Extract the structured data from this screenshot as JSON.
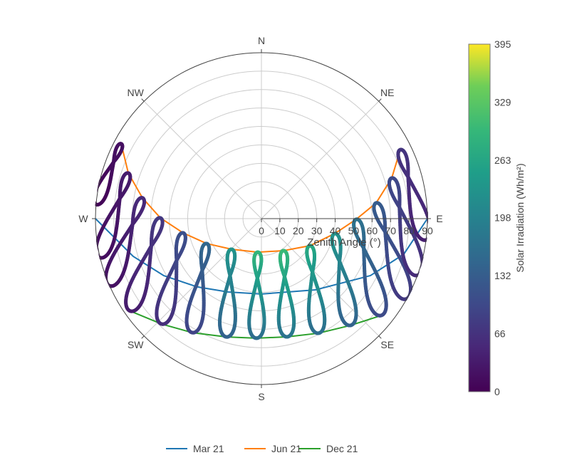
{
  "chart_data": {
    "type": "polar-scatter",
    "radial_axis": {
      "title": "Zenith Angle (°)",
      "range": [
        0,
        90
      ],
      "ticks": [
        "0",
        "10",
        "20",
        "30",
        "40",
        "50",
        "60",
        "70",
        "80",
        "90"
      ]
    },
    "angular_axis": {
      "direction": "clockwise",
      "rotation": "north-up",
      "labels": [
        {
          "az": 0,
          "text": "N"
        },
        {
          "az": 45,
          "text": "NE"
        },
        {
          "az": 90,
          "text": "E"
        },
        {
          "az": 135,
          "text": "SE"
        },
        {
          "az": 180,
          "text": "S"
        },
        {
          "az": 225,
          "text": "SW"
        },
        {
          "az": 270,
          "text": "W"
        },
        {
          "az": 315,
          "text": "NW"
        }
      ]
    },
    "grid": true,
    "sun_paths": [
      {
        "name": "Mar 21",
        "color": "#1f77b4",
        "points": [
          [
            270,
            90
          ],
          [
            253.6,
            72.5
          ],
          [
            239.7,
            61.3
          ],
          [
            223.2,
            50.8
          ],
          [
            204.5,
            43.7
          ],
          [
            180,
            40.9
          ],
          [
            142.8,
            48.5
          ],
          [
            117.6,
            66.7
          ],
          [
            104,
            79.6
          ],
          [
            90,
            90
          ]
        ]
      },
      {
        "name": "Jun 21",
        "color": "#ff7f0e",
        "points": [
          [
            298.1,
            86.2
          ],
          [
            288.9,
            76.3
          ],
          [
            279.9,
            65.5
          ],
          [
            270.4,
            54.8
          ],
          [
            259.7,
            43.2
          ],
          [
            245.6,
            32.7
          ],
          [
            224.3,
            23.2
          ],
          [
            186.1,
            18.3
          ],
          [
            145.4,
            21.1
          ],
          [
            119.2,
            30.1
          ],
          [
            101.5,
            40.6
          ],
          [
            90.4,
            51.4
          ],
          [
            82.2,
            62.8
          ],
          [
            72.7,
            74
          ],
          [
            63.6,
            84.1
          ]
        ]
      },
      {
        "name": "Dec 21",
        "color": "#2ca02c",
        "points": [
          [
            234.8,
            87
          ],
          [
            223.4,
            78.7
          ],
          [
            211.2,
            72.3
          ],
          [
            196.4,
            66.9
          ],
          [
            182.4,
            64.9
          ],
          [
            167.8,
            65.6
          ],
          [
            153.6,
            69.4
          ],
          [
            140.2,
            75.4
          ],
          [
            129,
            83.5
          ]
        ]
      }
    ],
    "analemmas": [
      {
        "jun": [
          298.1,
          86.2
        ],
        "dec": [
          274.9,
          90
        ],
        "irradiance": [
          20,
          5
        ]
      },
      {
        "jun": [
          288.9,
          76.3
        ],
        "dec": [
          256.4,
          90
        ],
        "irradiance": [
          35,
          15
        ]
      },
      {
        "jun": [
          279.9,
          65.5
        ],
        "dec": [
          246.1,
          90
        ],
        "irradiance": [
          55,
          20
        ]
      },
      {
        "jun": [
          270.4,
          54.8
        ],
        "dec": [
          234.8,
          87
        ],
        "irradiance": [
          75,
          35
        ]
      },
      {
        "jun": [
          259.7,
          43.2
        ],
        "dec": [
          223.4,
          78.7
        ],
        "irradiance": [
          110,
          60
        ]
      },
      {
        "jun": [
          245.6,
          32.7
        ],
        "dec": [
          211.2,
          72.3
        ],
        "irradiance": [
          150,
          90
        ]
      },
      {
        "jun": [
          224.3,
          23.2
        ],
        "dec": [
          196.4,
          66.9
        ],
        "irradiance": [
          230,
          140
        ]
      },
      {
        "jun": [
          186.1,
          18.3
        ],
        "dec": [
          182.4,
          64.9
        ],
        "irradiance": [
          290,
          160
        ]
      },
      {
        "jun": [
          145.4,
          21.1
        ],
        "dec": [
          167.8,
          65.6
        ],
        "irradiance": [
          300,
          170
        ]
      },
      {
        "jun": [
          119.2,
          30.1
        ],
        "dec": [
          153.6,
          69.4
        ],
        "irradiance": [
          270,
          160
        ]
      },
      {
        "jun": [
          101.5,
          40.6
        ],
        "dec": [
          140.2,
          75.4
        ],
        "irradiance": [
          230,
          140
        ]
      },
      {
        "jun": [
          90.4,
          51.4
        ],
        "dec": [
          129,
          83.5
        ],
        "irradiance": [
          170,
          100
        ]
      },
      {
        "jun": [
          82.2,
          62.8
        ],
        "dec": [
          119.1,
          89.7
        ],
        "irradiance": [
          130,
          75
        ]
      },
      {
        "jun": [
          72.7,
          74
        ],
        "dec": [
          110,
          90
        ],
        "irradiance": [
          100,
          55
        ]
      },
      {
        "jun": [
          63.6,
          84.1
        ],
        "dec": [
          97.4,
          90
        ],
        "irradiance": [
          70,
          40
        ]
      }
    ],
    "colorbar": {
      "title": "Solar Irradiation (Wh/m²)",
      "range": [
        0,
        395
      ],
      "ticks": [
        "0",
        "66",
        "132",
        "198",
        "263",
        "329",
        "395"
      ],
      "colorscale": [
        [
          0,
          "#440154"
        ],
        [
          0.13,
          "#482878"
        ],
        [
          0.25,
          "#3e4989"
        ],
        [
          0.38,
          "#31688e"
        ],
        [
          0.5,
          "#26828e"
        ],
        [
          0.63,
          "#1f9e89"
        ],
        [
          0.75,
          "#35b779"
        ],
        [
          0.88,
          "#6ece58"
        ],
        [
          1,
          "#fde725"
        ]
      ]
    },
    "legend": {
      "placement": "bottom-center",
      "entries": [
        "Mar 21",
        "Jun 21",
        "Dec 21"
      ]
    }
  }
}
